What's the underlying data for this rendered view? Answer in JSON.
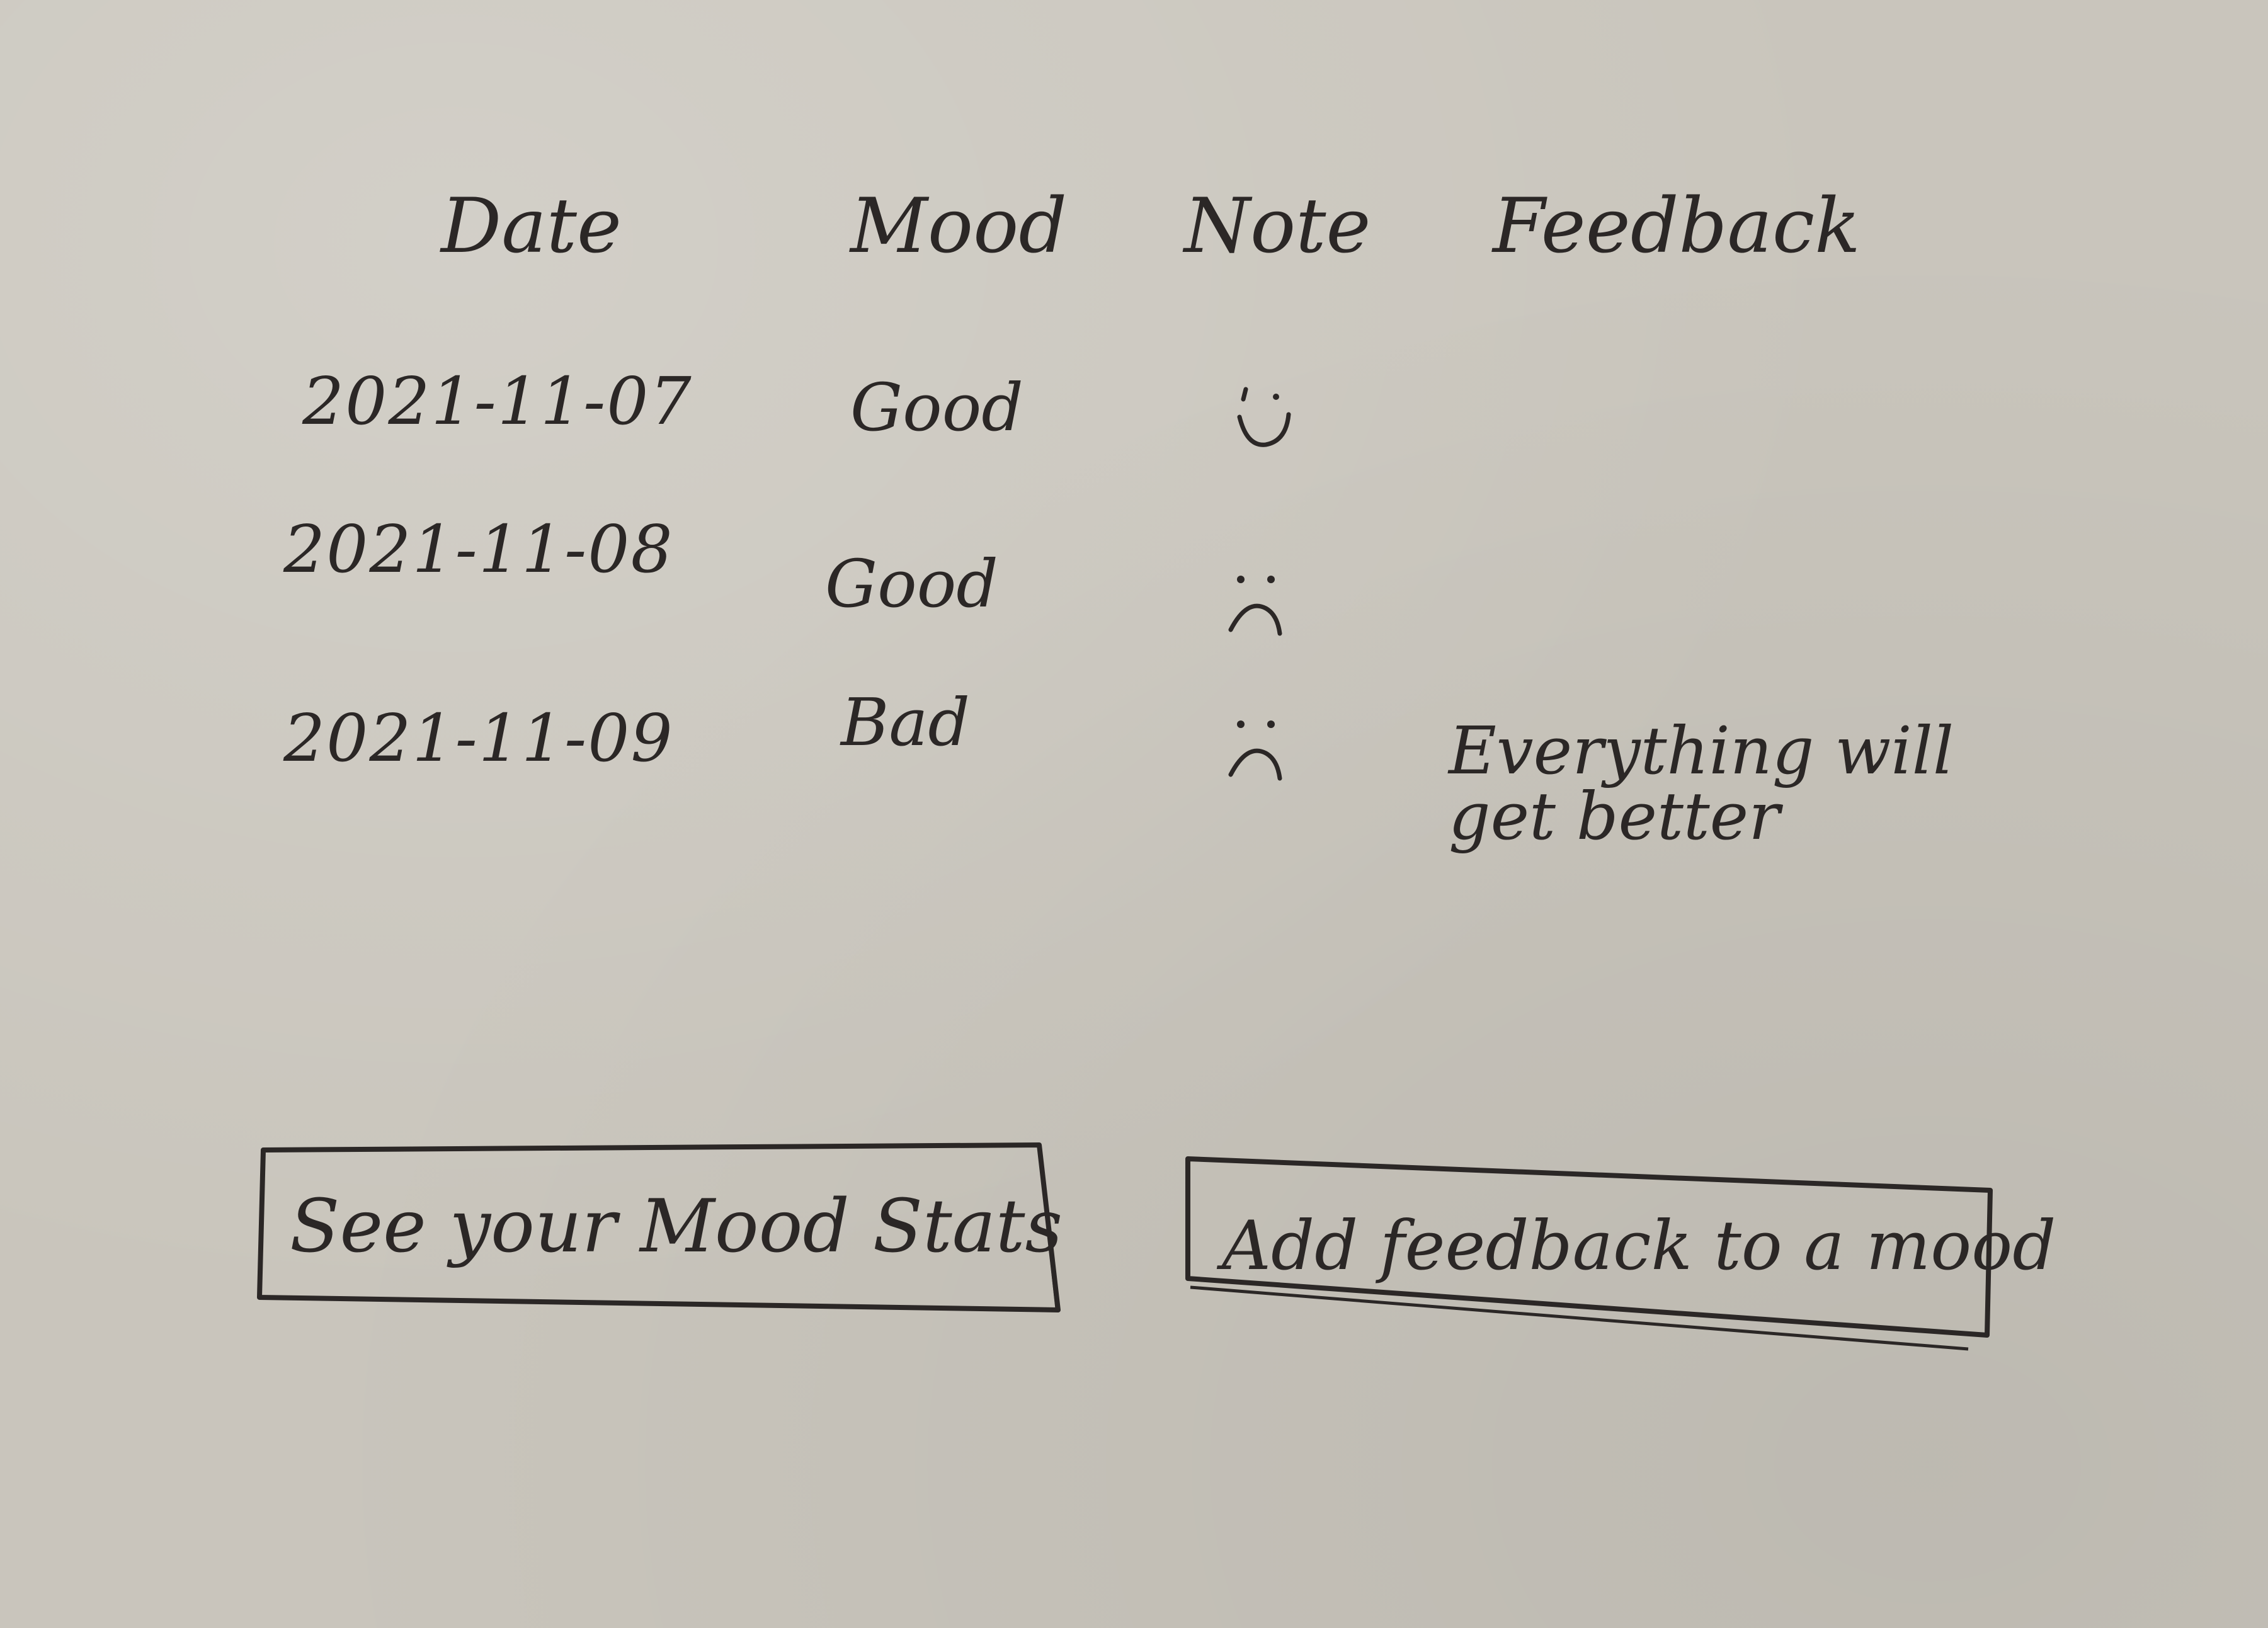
{
  "table": {
    "headers": {
      "date": "Date",
      "mood": "Mood",
      "note": "Note",
      "feedback": "Feedback"
    },
    "rows": [
      {
        "date": "2021-11-07",
        "mood": "Good",
        "note_icon": "smiley-face-icon",
        "feedback": ""
      },
      {
        "date": "2021-11-08",
        "mood": "Good",
        "note_icon": "frowny-face-icon",
        "feedback": ""
      },
      {
        "date": "2021-11-09",
        "mood": "Bad",
        "note_icon": "frowny-face-icon",
        "feedback": "Everything will get better"
      }
    ]
  },
  "actions": {
    "see_stats_label": "See your Mood Stats",
    "add_feedback_label": "Add feedback to a mood"
  },
  "colors": {
    "paper": "#c9c5bc",
    "ink": "#2b2726"
  }
}
